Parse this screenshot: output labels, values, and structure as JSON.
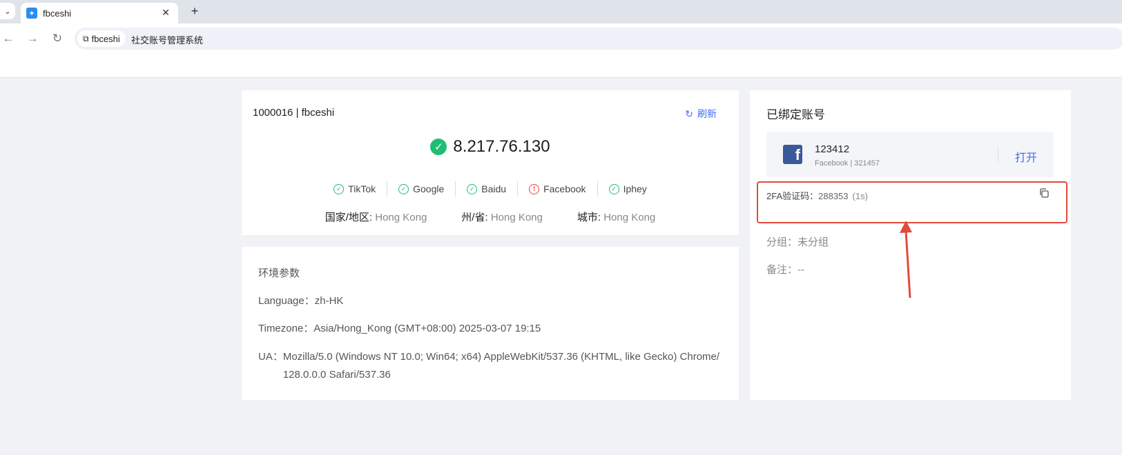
{
  "browser": {
    "tab_title": "fbceshi",
    "tab_close": "✕",
    "new_tab": "+",
    "site_chip_label": "fbceshi",
    "page_title_text": "社交账号管理系统"
  },
  "profile": {
    "title": "1000016 | fbceshi",
    "refresh_label": "刷新",
    "ip": "8.217.76.130",
    "checks": [
      {
        "label": "TikTok",
        "status": "ok"
      },
      {
        "label": "Google",
        "status": "ok"
      },
      {
        "label": "Baidu",
        "status": "ok"
      },
      {
        "label": "Facebook",
        "status": "error"
      },
      {
        "label": "Iphey",
        "status": "ok"
      }
    ],
    "location": {
      "country_label": "国家/地区:",
      "country_value": "Hong Kong",
      "province_label": "州/省:",
      "province_value": "Hong Kong",
      "city_label": "城市:",
      "city_value": "Hong Kong"
    }
  },
  "env": {
    "title": "环境参数",
    "language_label": "Language：",
    "language_value": "zh-HK",
    "timezone_label": "Timezone：",
    "timezone_value": "Asia/Hong_Kong (GMT+08:00) 2025-03-07 19:15",
    "ua_label": "UA：",
    "ua_value": "Mozilla/5.0 (Windows NT 10.0; Win64; x64) AppleWebKit/537.36 (KHTML, like Gecko) Chrome/128.0.0.0 Safari/537.36"
  },
  "bound": {
    "title": "已绑定账号",
    "account": {
      "name": "123412",
      "sub": "Facebook | 321457",
      "open_label": "打开"
    },
    "twofa_label": "2FA验证码：",
    "twofa_code": "288353",
    "twofa_seconds": "(1s)",
    "group_label": "分组：",
    "group_value": "未分组",
    "note_label": "备注：",
    "note_value": "--"
  },
  "colors": {
    "accent": "#3e6ef2",
    "success": "#1ebe72",
    "error": "#e8453c",
    "annotation": "#e24a3b",
    "facebook": "#3b5998"
  }
}
